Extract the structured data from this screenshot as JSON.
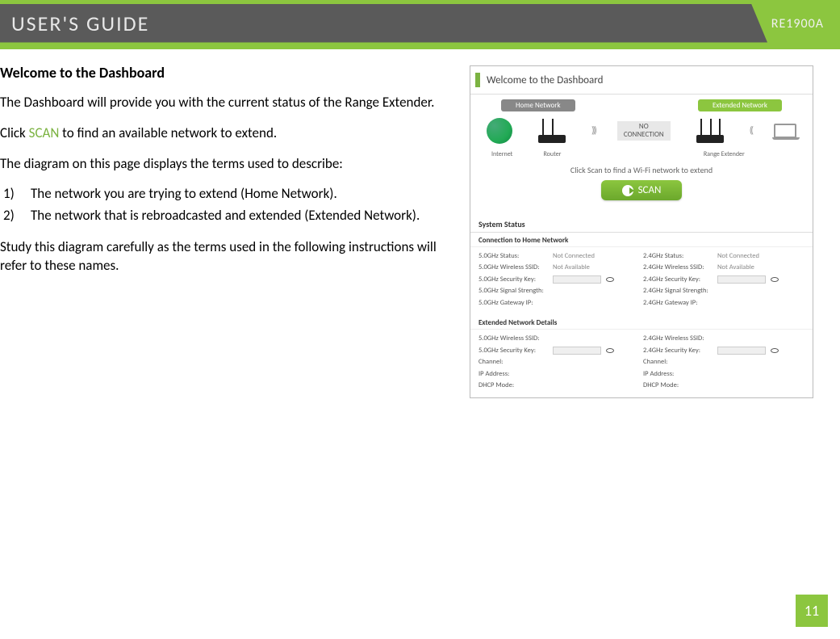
{
  "header": {
    "title": "USER'S GUIDE",
    "model": "RE1900A"
  },
  "main": {
    "section_heading": "Welcome to the Dashboard",
    "para1": "The Dashboard will provide you with the current status of the Range Extender.",
    "para2_pre": "Click ",
    "para2_scan": "SCAN",
    "para2_post": " to find an available network to extend.",
    "para3": "The diagram on this page displays the terms used to describe:",
    "list": [
      {
        "num": "1)",
        "text": "The network you are trying to extend (Home Network)."
      },
      {
        "num": "2)",
        "text": "The network that is rebroadcasted and extended (Extended Network)."
      }
    ],
    "para4": "Study this diagram carefully as the terms used in the following instructions will refer to these names."
  },
  "dashboard": {
    "title": "Welcome to the Dashboard",
    "home_label": "Home Network",
    "ext_label": "Extended Network",
    "no_conn_line1": "NO",
    "no_conn_line2": "CONNECTION",
    "icon_labels": {
      "internet": "Internet",
      "router": "Router",
      "extender": "Range Extender"
    },
    "scan_prompt": "Click Scan to find a Wi-Fi network to extend",
    "scan_button": "SCAN",
    "sections": {
      "system_status": "System Status",
      "home_conn": "Connection to Home Network",
      "ext_details": "Extended Network Details"
    },
    "home_5g": {
      "status_label": "5.0GHz Status:",
      "status_val": "Not Connected",
      "ssid_label": "5.0GHz Wireless SSID:",
      "ssid_val": "Not Available",
      "key_label": "5.0GHz Security Key:",
      "signal_label": "5.0GHz Signal Strength:",
      "gateway_label": "5.0GHz Gateway IP:"
    },
    "home_24g": {
      "status_label": "2.4GHz Status:",
      "status_val": "Not Connected",
      "ssid_label": "2.4GHz Wireless SSID:",
      "ssid_val": "Not Available",
      "key_label": "2.4GHz Security Key:",
      "signal_label": "2.4GHz Signal Strength:",
      "gateway_label": "2.4GHz Gateway IP:"
    },
    "ext_5g": {
      "ssid_label": "5.0GHz Wireless SSID:",
      "key_label": "5.0GHz Security Key:",
      "channel_label": "Channel:",
      "ip_label": "IP Address:",
      "dhcp_label": "DHCP Mode:"
    },
    "ext_24g": {
      "ssid_label": "2.4GHz Wireless SSID:",
      "key_label": "2.4GHz Security Key:",
      "channel_label": "Channel:",
      "ip_label": "IP Address:",
      "dhcp_label": "DHCP Mode:"
    }
  },
  "page_number": "11"
}
